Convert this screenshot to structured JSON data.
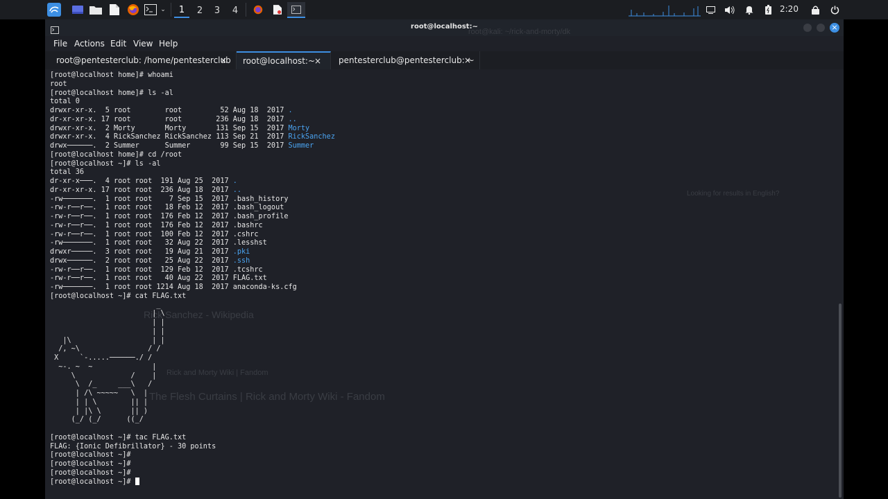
{
  "taskbar": {
    "workspaces": [
      "1",
      "2",
      "3",
      "4"
    ],
    "active_workspace": "1",
    "clock": "2:20",
    "launcher_icons": [
      "kali-menu-icon",
      "desktop-icon",
      "files-icon",
      "text-editor-icon",
      "firefox-icon",
      "terminal-icon"
    ],
    "tray_icons": [
      "display-icon",
      "volume-icon",
      "bell-icon",
      "battery-icon",
      "lock-icon",
      "power-icon"
    ]
  },
  "window": {
    "title": "root@localhost:~",
    "menus": [
      "File",
      "Actions",
      "Edit",
      "View",
      "Help"
    ],
    "tabs": [
      {
        "label": "root@pentesterclub: /home/pentesterclub",
        "active": false
      },
      {
        "label": "root@localhost:~",
        "active": true
      },
      {
        "label": "pentesterclub@pentesterclub: ~",
        "active": false
      }
    ],
    "close_glyph": "×"
  },
  "terminal": {
    "lines": [
      [
        {
          "t": "[root@localhost home]# whoami"
        }
      ],
      [
        {
          "t": "root"
        }
      ],
      [
        {
          "t": "[root@localhost home]# ls -al"
        }
      ],
      [
        {
          "t": "total 0"
        }
      ],
      [
        {
          "t": "drwxr-xr-x.  5 root        root         52 Aug 18  2017 "
        },
        {
          "t": ".",
          "c": "blue"
        }
      ],
      [
        {
          "t": "dr-xr-xr-x. 17 root        root        236 Aug 18  2017 "
        },
        {
          "t": "..",
          "c": "blue"
        }
      ],
      [
        {
          "t": "drwxr-xr-x.  2 Morty       Morty       131 Sep 15  2017 "
        },
        {
          "t": "Morty",
          "c": "blue"
        }
      ],
      [
        {
          "t": "drwxr-xr-x.  4 RickSanchez RickSanchez 113 Sep 21  2017 "
        },
        {
          "t": "RickSanchez",
          "c": "blue"
        }
      ],
      [
        {
          "t": "drwx──────.  2 Summer      Summer       99 Sep 15  2017 "
        },
        {
          "t": "Summer",
          "c": "blue"
        }
      ],
      [
        {
          "t": "[root@localhost home]# cd /root"
        }
      ],
      [
        {
          "t": "[root@localhost ~]# ls -al"
        }
      ],
      [
        {
          "t": "total 36"
        }
      ],
      [
        {
          "t": "dr-xr-x───.  4 root root  191 Aug 25  2017 "
        },
        {
          "t": ".",
          "c": "blue"
        }
      ],
      [
        {
          "t": "dr-xr-xr-x. 17 root root  236 Aug 18  2017 "
        },
        {
          "t": "..",
          "c": "blue"
        }
      ],
      [
        {
          "t": "-rw───────.  1 root root    7 Sep 15  2017 .bash_history"
        }
      ],
      [
        {
          "t": "-rw-r──r──.  1 root root   18 Feb 12  2017 .bash_logout"
        }
      ],
      [
        {
          "t": "-rw-r──r──.  1 root root  176 Feb 12  2017 .bash_profile"
        }
      ],
      [
        {
          "t": "-rw-r──r──.  1 root root  176 Feb 12  2017 .bashrc"
        }
      ],
      [
        {
          "t": "-rw-r──r──.  1 root root  100 Feb 12  2017 .cshrc"
        }
      ],
      [
        {
          "t": "-rw───────.  1 root root   32 Aug 22  2017 .lesshst"
        }
      ],
      [
        {
          "t": "drwxr─────.  3 root root   19 Aug 21  2017 "
        },
        {
          "t": ".pki",
          "c": "blue"
        }
      ],
      [
        {
          "t": "drwx──────.  2 root root   25 Aug 22  2017 "
        },
        {
          "t": ".ssh",
          "c": "blue"
        }
      ],
      [
        {
          "t": "-rw-r──r──.  1 root root  129 Feb 12  2017 .tcshrc"
        }
      ],
      [
        {
          "t": "-rw-r──r──.  1 root root   40 Aug 22  2017 FLAG.txt"
        }
      ],
      [
        {
          "t": "-rw───────.  1 root root 1214 Aug 18  2017 anaconda-ks.cfg"
        }
      ],
      [
        {
          "t": "[root@localhost ~]# cat FLAG.txt"
        }
      ],
      [
        {
          "t": "                         _"
        }
      ],
      [
        {
          "t": "                        | \\"
        }
      ],
      [
        {
          "t": "                        | |"
        }
      ],
      [
        {
          "t": "                        | |"
        }
      ],
      [
        {
          "t": "   |\\                   | |"
        }
      ],
      [
        {
          "t": "  /, ~\\                / /"
        }
      ],
      [
        {
          "t": " X     `-.....──────./ /"
        }
      ],
      [
        {
          "t": "  ~-. ~  ~              |"
        }
      ],
      [
        {
          "t": "     \\             /    |"
        }
      ],
      [
        {
          "t": "      \\  /_     ___\\   /"
        }
      ],
      [
        {
          "t": "      | /\\ ~~~~~   \\  |"
        }
      ],
      [
        {
          "t": "      | | \\        || |"
        }
      ],
      [
        {
          "t": "      | |\\ \\       || )"
        }
      ],
      [
        {
          "t": "     (_/ (_/      ((_/"
        }
      ],
      [
        {
          "t": ""
        }
      ],
      [
        {
          "t": "[root@localhost ~]# tac FLAG.txt"
        }
      ],
      [
        {
          "t": "FLAG: {Ionic Defibrillator} - 30 points"
        }
      ],
      [
        {
          "t": "[root@localhost ~]#"
        }
      ],
      [
        {
          "t": "[root@localhost ~]#"
        }
      ],
      [
        {
          "t": "[root@localhost ~]#"
        }
      ],
      [
        {
          "t": "[root@localhost ~]# "
        },
        {
          "t": "",
          "c": "cursor"
        }
      ]
    ]
  },
  "background_ghost_text": [
    "root@kali: ~/rick-and-morty/dk",
    "Rick and Morty Wiki | Fandom",
    "Rick Sanchez - Wikipedia",
    "The Flesh Curtains | Rick and Morty Wiki - Fandom",
    "Looking for results in English?"
  ],
  "colors": {
    "accent": "#3d8fe3",
    "terminal_bg": "#1f2128",
    "dir_color": "#4aa3f0",
    "text": "#e6e6e6"
  }
}
